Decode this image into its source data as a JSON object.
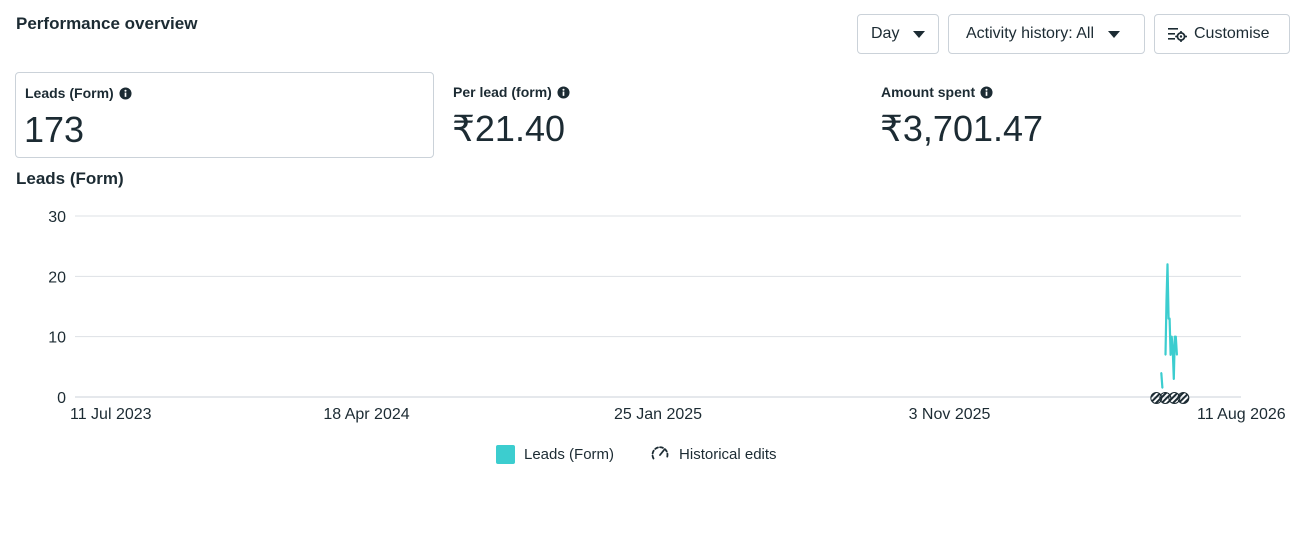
{
  "header": {
    "title": "Performance overview"
  },
  "toolbar": {
    "day_label": "Day",
    "activity_label": "Activity history: All",
    "customise_label": "Customise"
  },
  "metrics": [
    {
      "label": "Leads (Form)",
      "value": "173"
    },
    {
      "label": "Per lead (form)",
      "value": "₹21.40"
    },
    {
      "label": "Amount spent",
      "value": "₹3,701.47"
    }
  ],
  "colors": {
    "accent": "#3ccdcf",
    "text": "#1c2b33",
    "grid": "#dde1e4",
    "axis": "#cbd2d9"
  },
  "chart_data": {
    "type": "line",
    "title": "Leads (Form)",
    "ylim": [
      0,
      30
    ],
    "yticks": [
      0,
      10,
      20,
      30
    ],
    "xticks": [
      "11 Jul 2023",
      "18 Apr 2024",
      "25 Jan 2025",
      "3 Nov 2025",
      "11 Aug 2026"
    ],
    "xlim": [
      "2023-07-11",
      "2026-08-11"
    ],
    "grid": true,
    "legend_position": "bottom-center",
    "series": [
      {
        "name": "Leads (Form)",
        "color": "#3ccdcf",
        "points": [
          {
            "x": "2026-05-26",
            "y": 4
          },
          {
            "x": "2026-05-27",
            "y": 1.5
          },
          {
            "x": "2026-05-30",
            "y": 7
          },
          {
            "x": "2026-05-31",
            "y": 16
          },
          {
            "x": "2026-06-01",
            "y": 22
          },
          {
            "x": "2026-06-02",
            "y": 13
          },
          {
            "x": "2026-06-03",
            "y": 13
          },
          {
            "x": "2026-06-04",
            "y": 7
          },
          {
            "x": "2026-06-05",
            "y": 10
          },
          {
            "x": "2026-06-06",
            "y": 8
          },
          {
            "x": "2026-06-07",
            "y": 3
          },
          {
            "x": "2026-06-08",
            "y": 10
          },
          {
            "x": "2026-06-09",
            "y": 10
          },
          {
            "x": "2026-06-10",
            "y": 7
          }
        ]
      }
    ]
  },
  "legend": {
    "items": [
      {
        "label": "Leads (Form)",
        "icon": "color-swatch"
      },
      {
        "label": "Historical edits",
        "icon": "gauge-icon"
      }
    ]
  }
}
